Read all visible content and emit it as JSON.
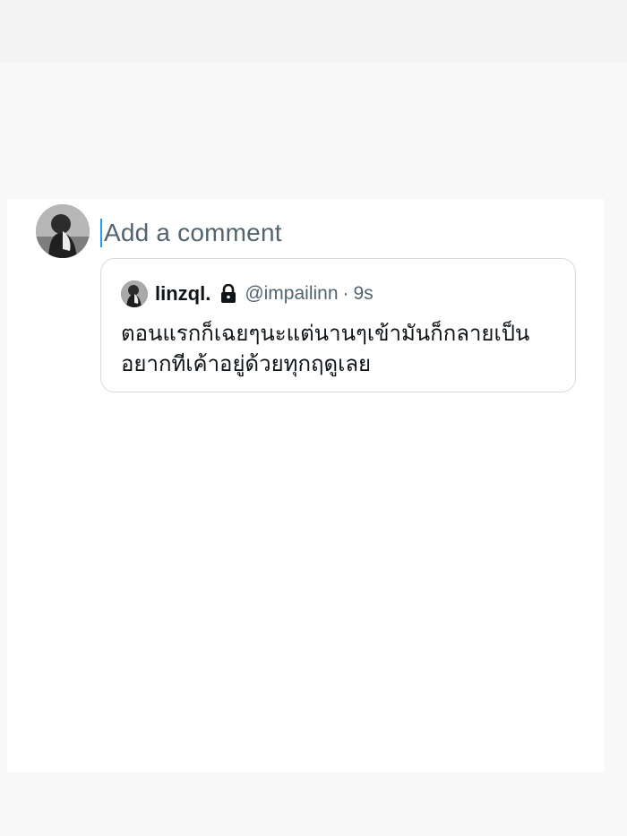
{
  "compose": {
    "placeholder": "Add a comment"
  },
  "quoted_post": {
    "display_name": "linzql.",
    "handle": "@impailinn",
    "separator": "·",
    "time": "9s",
    "text_lines": [
      "ตอนแรกก็เฉยๆนะแต่นานๆเข้ามันก็กลายเป็น",
      "อยากทีเค้าอยู่ด้วยทุกฤดูเลย"
    ]
  },
  "icons": {
    "user_avatar": "avatar",
    "author_avatar": "avatar",
    "protected_account": "lock-icon"
  },
  "colors": {
    "caret": "#1d9bf0",
    "placeholder": "#536471",
    "text": "#0f1419",
    "border": "#d7dbe0"
  }
}
